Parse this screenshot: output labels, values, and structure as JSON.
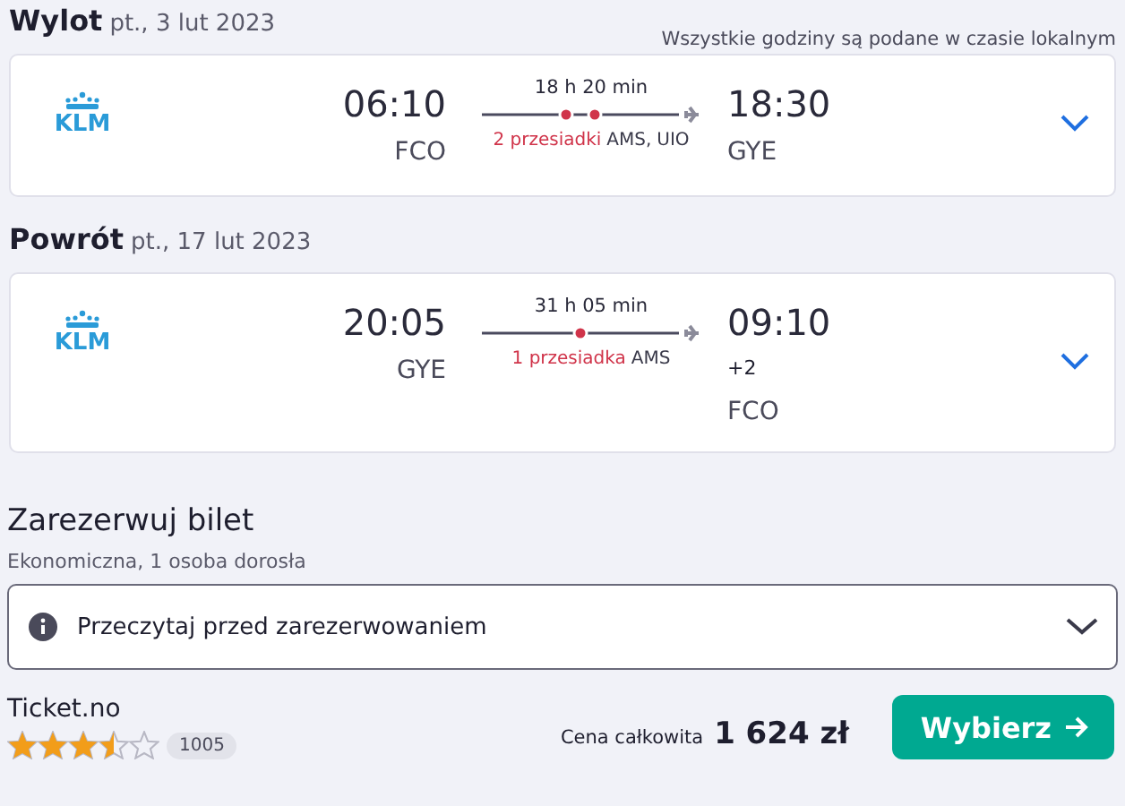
{
  "legs": [
    {
      "label": "Wylot",
      "date": "pt., 3 lut 2023",
      "note": "Wszystkie godziny są podane w czasie lokalnym",
      "airline": "KLM",
      "depart_time": "06:10",
      "depart_airport": "FCO",
      "duration": "18 h 20 min",
      "stops_label": "2 przesiadki",
      "layovers": [
        "AMS,",
        "UIO"
      ],
      "arrive_time": "18:30",
      "arrive_airport": "GYE",
      "expanded": false
    },
    {
      "label": "Powrót",
      "date": "pt., 17 lut 2023",
      "airline": "KLM",
      "depart_time": "20:05",
      "depart_airport": "GYE",
      "duration": "31 h 05 min",
      "stops_label": "1 przesiadka",
      "layovers": [
        "AMS"
      ],
      "arrive_time": "09:10",
      "day_offset": "+2",
      "arrive_airport": "FCO",
      "expanded": false
    }
  ],
  "booking": {
    "title": "Zarezerwuj bilet",
    "subtitle": "Ekonomiczna, 1 osoba dorosła",
    "info": {
      "label": "Przeczytaj przed zarezerwowaniem",
      "expanded": false
    },
    "provider": "Ticket.no",
    "stars": 3.5,
    "reviews": "1005",
    "price_label": "Cena całkowita",
    "price": "1 624 zł",
    "button": "Wybierz"
  }
}
